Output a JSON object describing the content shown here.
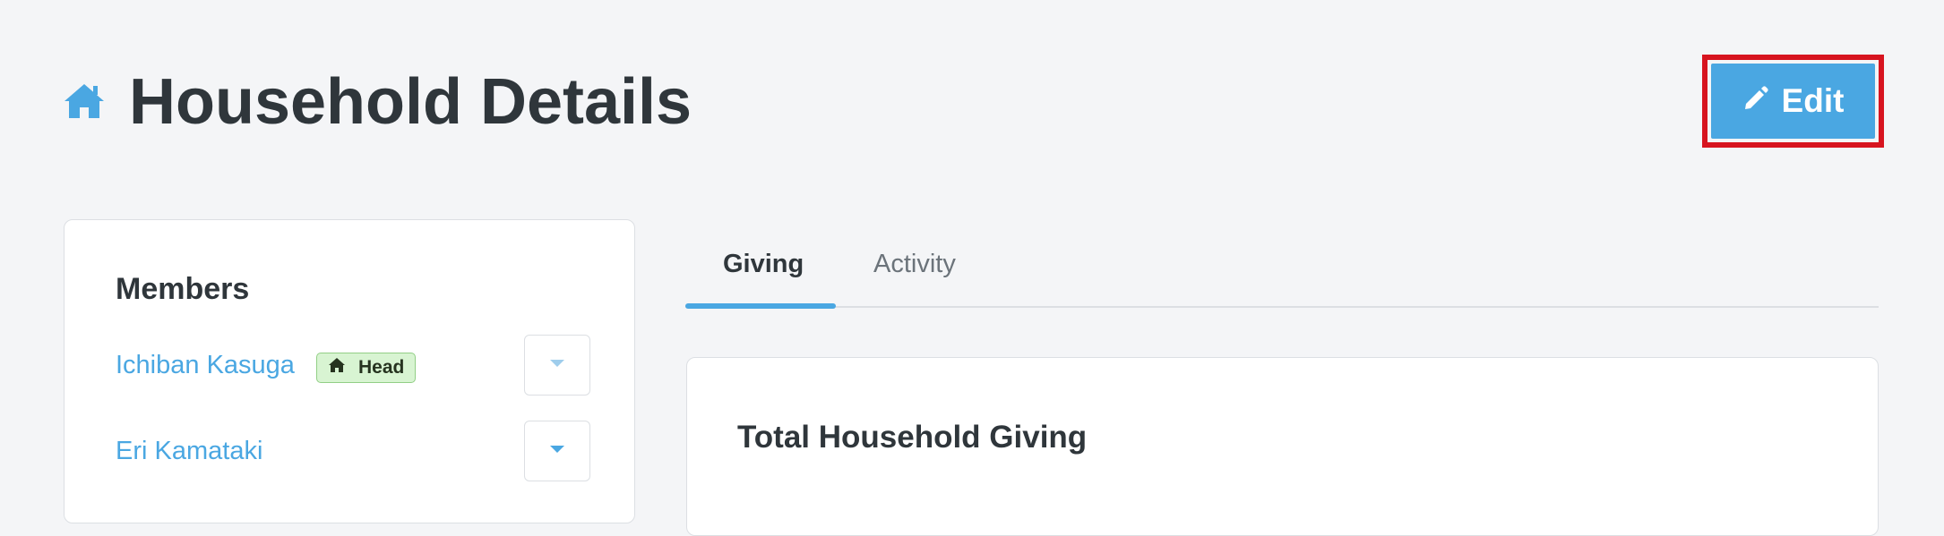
{
  "header": {
    "title": "Household Details",
    "icon": "home-icon",
    "edit_label": "Edit",
    "edit_icon": "pencil-icon"
  },
  "members": {
    "title": "Members",
    "items": [
      {
        "name": "Ichiban Kasuga",
        "badge": "Head",
        "badge_icon": "home-icon"
      },
      {
        "name": "Eri Kamataki"
      }
    ]
  },
  "tabs": [
    {
      "label": "Giving",
      "active": true
    },
    {
      "label": "Activity",
      "active": false
    }
  ],
  "giving": {
    "title": "Total Household Giving"
  },
  "colors": {
    "accent": "#4aa7e2",
    "highlight_outline": "#d7141f",
    "badge_bg": "#d8f4d2",
    "title_text": "#2f363b"
  }
}
